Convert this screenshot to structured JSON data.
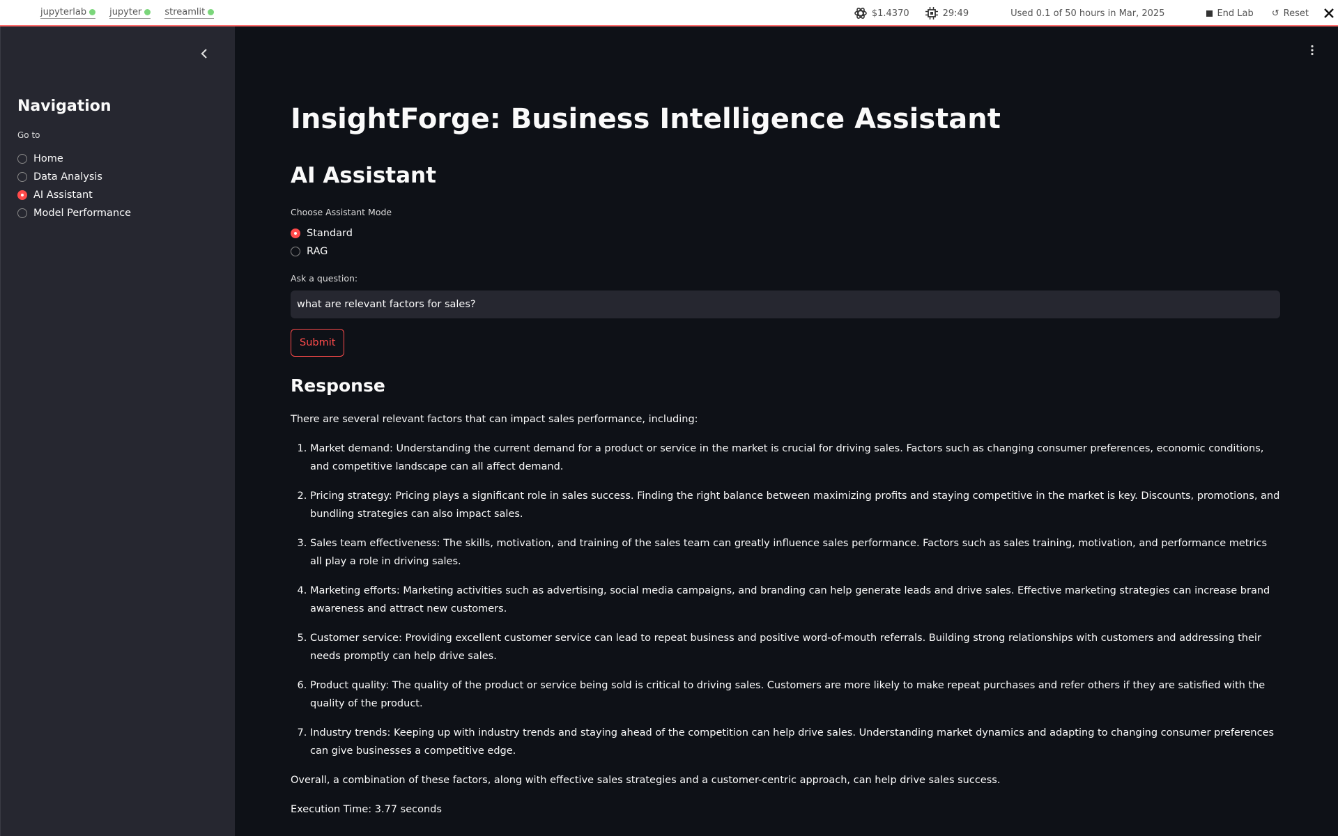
{
  "topbar": {
    "tabs": [
      {
        "label": "jupyterlab"
      },
      {
        "label": "jupyter"
      },
      {
        "label": "streamlit"
      }
    ],
    "cost": "$1.4370",
    "timer": "29:49",
    "usage": "Used 0.1 of 50 hours in Mar, 2025",
    "end_lab": "End Lab",
    "reset": "Reset"
  },
  "sidebar": {
    "title": "Navigation",
    "goto_label": "Go to",
    "items": [
      {
        "label": "Home",
        "selected": false
      },
      {
        "label": "Data Analysis",
        "selected": false
      },
      {
        "label": "AI Assistant",
        "selected": true
      },
      {
        "label": "Model Performance",
        "selected": false
      }
    ]
  },
  "main": {
    "title": "InsightForge: Business Intelligence Assistant",
    "subtitle": "AI Assistant",
    "mode_label": "Choose Assistant Mode",
    "modes": [
      {
        "label": "Standard",
        "selected": true
      },
      {
        "label": "RAG",
        "selected": false
      }
    ],
    "question_label": "Ask a question:",
    "question_value": "what are relevant factors for sales?",
    "submit_label": "Submit",
    "response_heading": "Response",
    "response_intro": "There are several relevant factors that can impact sales performance, including:",
    "response_items": [
      "Market demand: Understanding the current demand for a product or service in the market is crucial for driving sales. Factors such as changing consumer preferences, economic conditions, and competitive landscape can all affect demand.",
      "Pricing strategy: Pricing plays a significant role in sales success. Finding the right balance between maximizing profits and staying competitive in the market is key. Discounts, promotions, and bundling strategies can also impact sales.",
      "Sales team effectiveness: The skills, motivation, and training of the sales team can greatly influence sales performance. Factors such as sales training, motivation, and performance metrics all play a role in driving sales.",
      "Marketing efforts: Marketing activities such as advertising, social media campaigns, and branding can help generate leads and drive sales. Effective marketing strategies can increase brand awareness and attract new customers.",
      "Customer service: Providing excellent customer service can lead to repeat business and positive word-of-mouth referrals. Building strong relationships with customers and addressing their needs promptly can help drive sales.",
      "Product quality: The quality of the product or service being sold is critical to driving sales. Customers are more likely to make repeat purchases and refer others if they are satisfied with the quality of the product.",
      "Industry trends: Keeping up with industry trends and staying ahead of the competition can help drive sales. Understanding market dynamics and adapting to changing consumer preferences can give businesses a competitive edge."
    ],
    "response_outro": "Overall, a combination of these factors, along with effective sales strategies and a customer-centric approach, can help drive sales success.",
    "execution_time": "Execution Time: 3.77 seconds"
  },
  "colors": {
    "accent": "#ff4b4b",
    "background": "#0e1117",
    "sidebar": "#262730",
    "status_dot": "#7bd67b"
  }
}
